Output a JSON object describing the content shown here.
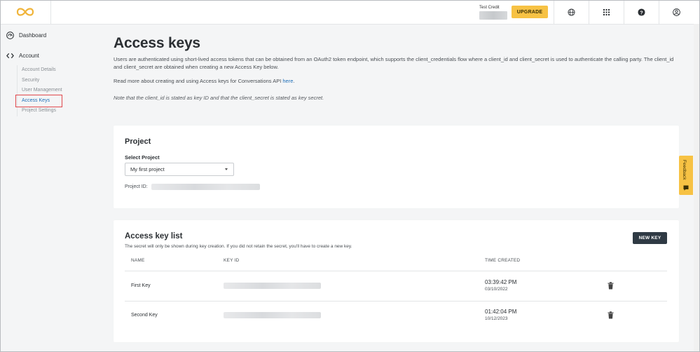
{
  "topbar": {
    "credit_label": "Test Credit",
    "upgrade_label": "UPGRADE",
    "icons": [
      "globe-icon",
      "apps-grid-icon",
      "help-icon",
      "user-icon"
    ]
  },
  "sidebar": {
    "dashboard": "Dashboard",
    "account": "Account",
    "items": [
      {
        "label": "Account Details"
      },
      {
        "label": "Security"
      },
      {
        "label": "User Management"
      },
      {
        "label": "Access Keys",
        "active": true
      },
      {
        "label": "Project Settings"
      }
    ]
  },
  "page": {
    "title": "Access keys",
    "description": "Users are authenticated using short-lived access tokens that can be obtained from an OAuth2 token endpoint, which supports the client_credentials flow where a client_id and client_secret is used to authenticate the calling party. The client_id and client_secret are obtained when creating a new Access Key below.",
    "read_more_prefix": "Read more about creating and using Access keys for Conversations API ",
    "read_more_link": "here",
    "read_more_suffix": ".",
    "note": "Note that the client_id is stated as key ID and that the client_secret is stated as key secret."
  },
  "project": {
    "heading": "Project",
    "select_label": "Select Project",
    "selected": "My first project",
    "id_label": "Project ID:"
  },
  "keys": {
    "heading": "Access key list",
    "subtext": "The secret will only be shown during key creation. If you did not retain the secret, you'll have to create a new key.",
    "new_key_label": "NEW KEY",
    "columns": {
      "name": "NAME",
      "key_id": "KEY ID",
      "time": "TIME CREATED"
    },
    "rows": [
      {
        "name": "First Key",
        "time": "03:39:42 PM",
        "date": "03/10/2022"
      },
      {
        "name": "Second Key",
        "time": "01:42:04 PM",
        "date": "10/12/2023"
      }
    ]
  },
  "feedback_label": "Feedback",
  "colors": {
    "accent": "#f7c244",
    "link": "#1f6fb8",
    "dark_button": "#2f3a44",
    "highlight": "#e0474c"
  }
}
